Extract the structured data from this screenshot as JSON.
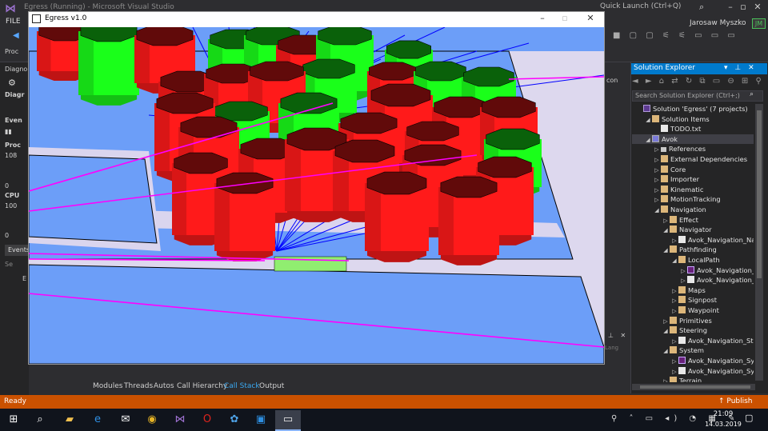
{
  "vs": {
    "title": "Egress (Running) - Microsoft Visual Studio",
    "quick_launch_placeholder": "Quick Launch (Ctrl+Q)",
    "menu_file": "FILE",
    "user_name": "Jarosaw Myszko",
    "user_initials": "JM",
    "toolbar_partial": "Proc",
    "diag_title": "Diagno",
    "diag_subtitle": "Diagr",
    "diag_events": "Even",
    "diag_process": "Proc",
    "diag_108": "108",
    "diag_0a": "0",
    "diag_cpu": "CPU",
    "diag_100": "100",
    "diag_0b": "0",
    "events_tab": "Events",
    "diag_se": "Se",
    "diag_e": "E",
    "mid_con": "con",
    "lang": "Lang"
  },
  "bottom_tabs": [
    "Modules",
    "Threads",
    "Autos",
    "Call Hierarchy",
    "Call Stack",
    "Output"
  ],
  "bottom_tab_active": "Call Stack",
  "solution_explorer": {
    "title": "Solution Explorer",
    "search_placeholder": "Search Solution Explorer (Ctrl+;)",
    "items": [
      {
        "label": "Solution 'Egress' (7 projects)",
        "depth": 0,
        "arrow": "",
        "icon": "sln"
      },
      {
        "label": "Solution Items",
        "depth": 1,
        "arrow": "◢",
        "icon": "folder"
      },
      {
        "label": "TODO.txt",
        "depth": 2,
        "arrow": "",
        "icon": "file"
      },
      {
        "label": "Avok",
        "depth": 1,
        "arrow": "◢",
        "icon": "proj",
        "selected": true
      },
      {
        "label": "References",
        "depth": 2,
        "arrow": "▷",
        "icon": "ref"
      },
      {
        "label": "External Dependencies",
        "depth": 2,
        "arrow": "▷",
        "icon": "folder"
      },
      {
        "label": "Core",
        "depth": 2,
        "arrow": "▷",
        "icon": "folder"
      },
      {
        "label": "Importer",
        "depth": 2,
        "arrow": "▷",
        "icon": "folder"
      },
      {
        "label": "Kinematic",
        "depth": 2,
        "arrow": "▷",
        "icon": "folder"
      },
      {
        "label": "MotionTracking",
        "depth": 2,
        "arrow": "▷",
        "icon": "folder"
      },
      {
        "label": "Navigation",
        "depth": 2,
        "arrow": "◢",
        "icon": "folder"
      },
      {
        "label": "Effect",
        "depth": 3,
        "arrow": "▷",
        "icon": "folder"
      },
      {
        "label": "Navigator",
        "depth": 3,
        "arrow": "◢",
        "icon": "folder"
      },
      {
        "label": "Avok_Navigation_Nav",
        "depth": 4,
        "arrow": "▷",
        "icon": "file"
      },
      {
        "label": "Pathfinding",
        "depth": 3,
        "arrow": "◢",
        "icon": "folder"
      },
      {
        "label": "LocalPath",
        "depth": 4,
        "arrow": "◢",
        "icon": "folder"
      },
      {
        "label": "Avok_Navigation_",
        "depth": 5,
        "arrow": "▷",
        "icon": "cs"
      },
      {
        "label": "Avok_Navigation_",
        "depth": 5,
        "arrow": "▷",
        "icon": "file"
      },
      {
        "label": "Maps",
        "depth": 4,
        "arrow": "▷",
        "icon": "folder"
      },
      {
        "label": "Signpost",
        "depth": 4,
        "arrow": "▷",
        "icon": "folder"
      },
      {
        "label": "Waypoint",
        "depth": 4,
        "arrow": "▷",
        "icon": "folder"
      },
      {
        "label": "Primitives",
        "depth": 3,
        "arrow": "▷",
        "icon": "folder"
      },
      {
        "label": "Steering",
        "depth": 3,
        "arrow": "◢",
        "icon": "folder"
      },
      {
        "label": "Avok_Navigation_Stee",
        "depth": 4,
        "arrow": "▷",
        "icon": "file"
      },
      {
        "label": "System",
        "depth": 3,
        "arrow": "◢",
        "icon": "folder"
      },
      {
        "label": "Avok_Navigation_Syst",
        "depth": 4,
        "arrow": "▷",
        "icon": "cs"
      },
      {
        "label": "Avok_Navigation_Syst",
        "depth": 4,
        "arrow": "▷",
        "icon": "file"
      },
      {
        "label": "Terrain",
        "depth": 3,
        "arrow": "▷",
        "icon": "folder"
      }
    ]
  },
  "status": {
    "left": "Ready",
    "right": "Publish"
  },
  "taskbar": {
    "time": "21:09",
    "date": "14.03.2019"
  },
  "egress": {
    "title": "Egress v1.0"
  },
  "colors": {
    "vs_accent": "#007acc",
    "status_bar": "#ca5100",
    "floor": "#6c9ef8",
    "cylinder_red": "#ff1a1a",
    "cylinder_green": "#1aff1a",
    "ray_blue": "#0000ff",
    "path_magenta": "#ff00ff"
  }
}
